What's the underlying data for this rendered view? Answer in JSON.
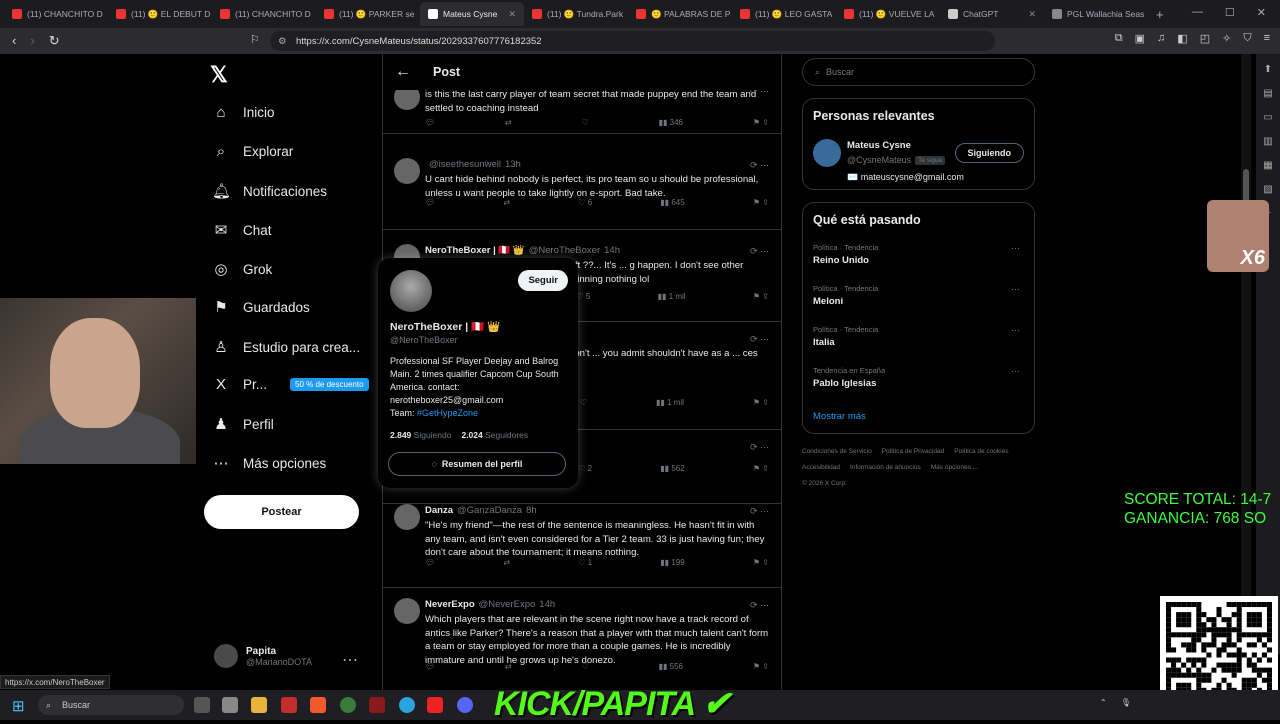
{
  "browser": {
    "tabs": [
      {
        "label": "(11) CHANCHITO D",
        "color": "#e33"
      },
      {
        "label": "(11) 🙂 EL DEBUT D",
        "color": "#e33"
      },
      {
        "label": "(11) CHANCHITO D",
        "color": "#e33"
      },
      {
        "label": "(11) 🙂 PARKER se",
        "color": "#e33"
      },
      {
        "label": "Mateus Cysne",
        "color": "#fff",
        "active": true
      },
      {
        "label": "(11) 🙂 Tundra.Park",
        "color": "#e33"
      },
      {
        "label": "🙂 PALABRAS DE P",
        "color": "#e33"
      },
      {
        "label": "(11) 🙂 LEO GASTA",
        "color": "#e33"
      },
      {
        "label": "(11) 🙂 VUELVE LA",
        "color": "#e33"
      },
      {
        "label": "ChatGPT",
        "color": "#ccc"
      },
      {
        "label": "PGL Wallachia Seas",
        "color": "#888"
      }
    ],
    "url": "https://x.com/CysneMateus/status/2029337607776182352",
    "status_url": "https://x.com/NeroTheBoxer"
  },
  "sidebar": {
    "items": [
      {
        "icon": "home-icon",
        "glyph": "⌂",
        "label": "Inicio"
      },
      {
        "icon": "search-icon",
        "glyph": "⌕",
        "label": "Explorar"
      },
      {
        "icon": "bell-icon",
        "glyph": "🔔︎",
        "label": "Notificaciones"
      },
      {
        "icon": "mail-icon",
        "glyph": "✉",
        "label": "Chat"
      },
      {
        "icon": "grok-icon",
        "glyph": "◎",
        "label": "Grok"
      },
      {
        "icon": "bookmark-icon",
        "glyph": "⚑",
        "label": "Guardados"
      },
      {
        "icon": "studio-icon",
        "glyph": "♙",
        "label": "Estudio para crea..."
      },
      {
        "icon": "premium-x-icon",
        "glyph": "X",
        "label": "Pr...",
        "badge": "50 % de descuento"
      },
      {
        "icon": "profile-icon",
        "glyph": "♟",
        "label": "Perfil"
      },
      {
        "icon": "more-icon",
        "glyph": "⋯",
        "label": "Más opciones"
      }
    ],
    "post_button": "Postear",
    "account": {
      "name": "Papita",
      "handle": "@MarianoDOTA"
    }
  },
  "feed": {
    "title": "Post",
    "tweets": [
      {
        "name": "",
        "handle": "",
        "time": "",
        "text": "is this the last carry player of team secret that made puppey end the team and settled to coaching instead",
        "replies": "",
        "retweets": "",
        "likes": "",
        "views": "346"
      },
      {
        "name": "",
        "handle": "@iseethesunwell",
        "time": "13h",
        "text": "U cant hide behind nobody is perfect, its pro team so u should be professional, unless u want people to take lightly on e-sport. Bad take.",
        "replies": "",
        "retweets": "",
        "likes": "6",
        "views": "645"
      },
      {
        "name": "NeroTheBoxer | 🇵🇪 👑",
        "handle": "@NeroTheBoxer",
        "time": "14h",
        "text": "... our cellphone and also in the draft ??... It's ... g happen. I don't see other player's do that ... he best without winning nothing lol",
        "replies": "",
        "retweets": "",
        "likes": "5",
        "views": "1 mil"
      },
      {
        "name": "",
        "handle": "",
        "time": "15h",
        "text": "... proved time and time again he won't ... you admit shouldn't have as a ... ces you want him to have? Unlimited?",
        "replies": "",
        "retweets": "",
        "likes": "",
        "views": "1 mil"
      },
      {
        "name": "",
        "handle": "",
        "time": "13h",
        "text": "",
        "replies": "",
        "retweets": "",
        "likes": "2",
        "views": "562"
      },
      {
        "name": "Danza",
        "handle": "@GanzaDanza",
        "time": "8h",
        "text": "\"He's my friend\"—the rest of the sentence is meaningless. He hasn't fit in with any team, and isn't even considered for a Tier 2 team. 33 is just having fun; they don't care about the tournament; it means nothing.",
        "replies": "",
        "retweets": "",
        "likes": "1",
        "views": "199"
      },
      {
        "name": "NeverExpo",
        "handle": "@NeverExpo",
        "time": "14h",
        "text": "Which players that are relevant in the scene right now have a track record of antics like Parker? There's a reason that a player with that much talent can't form a team or stay employed for more than a couple games. He is incredibly immature and until he grows up he's donezo.",
        "replies": "",
        "retweets": "",
        "likes": "",
        "views": "556"
      }
    ]
  },
  "popup": {
    "name": "NeroTheBoxer | 🇵🇪 👑",
    "handle": "@NeroTheBoxer",
    "follow": "Seguir",
    "bio1": "Professional SF Player  Deejay and Balrog Main.  2 times qualifier Capcom Cup South America. contact: nerotheboxer25@gmail.com",
    "team_label": "Team: ",
    "team_tag": "#GetHypeZone",
    "following_count": "2.849",
    "following_label": "Siguiendo",
    "followers_count": "2.024",
    "followers_label": "Seguidores",
    "summary_button": "Resumen del perfil"
  },
  "right": {
    "search_placeholder": "Buscar",
    "relevant_title": "Personas relevantes",
    "person": {
      "name": "Mateus Cysne",
      "handle": "@CysneMateus",
      "tag": "Te sigue",
      "button": "Siguiendo",
      "email": "✉️ mateuscysne@gmail.com"
    },
    "trends_title": "Qué está pasando",
    "trends": [
      {
        "kicker": "Política · Tendencia",
        "name": "Reino Unido"
      },
      {
        "kicker": "Política · Tendencia",
        "name": "Meloni"
      },
      {
        "kicker": "Política · Tendencia",
        "name": "Italia"
      },
      {
        "kicker": "Tendencia en España",
        "name": "Pablo Iglesias"
      }
    ],
    "show_more": "Mostrar más",
    "footer": [
      "Condiciones de Servicio",
      "Política de Privacidad",
      "Política de cookies",
      "Accesibilidad",
      "Información de anuncios",
      "Más opciones ...",
      "© 2026 X Corp."
    ]
  },
  "overlay": {
    "score_line1": "SCORE TOTAL: 14-7",
    "score_line2": "GANANCIA: 768 SO",
    "meme_label": "X6",
    "kick": "KICK/PAPITA"
  },
  "taskbar": {
    "search": "Buscar"
  }
}
